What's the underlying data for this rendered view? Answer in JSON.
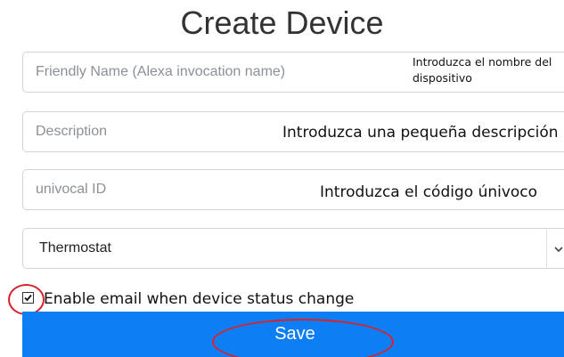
{
  "page": {
    "title": "Create Device"
  },
  "form": {
    "friendly_name": {
      "placeholder": "Friendly Name (Alexa invocation name)",
      "annotation": "Introduzca el nombre del dispositivo"
    },
    "description": {
      "placeholder": "Description",
      "annotation": "Introduzca una pequeña descripción"
    },
    "unique_id": {
      "placeholder": "univocal ID",
      "annotation": "Introduzca el código únivoco"
    },
    "device_type": {
      "selected": "Thermostat",
      "arrow_icon": "chevron-down-icon"
    },
    "email_notify": {
      "checked": true,
      "label": "Enable email when device status change"
    },
    "save_label": "Save"
  },
  "colors": {
    "primary_button": "#0d7ef3",
    "highlight_circle": "#d9232a"
  }
}
